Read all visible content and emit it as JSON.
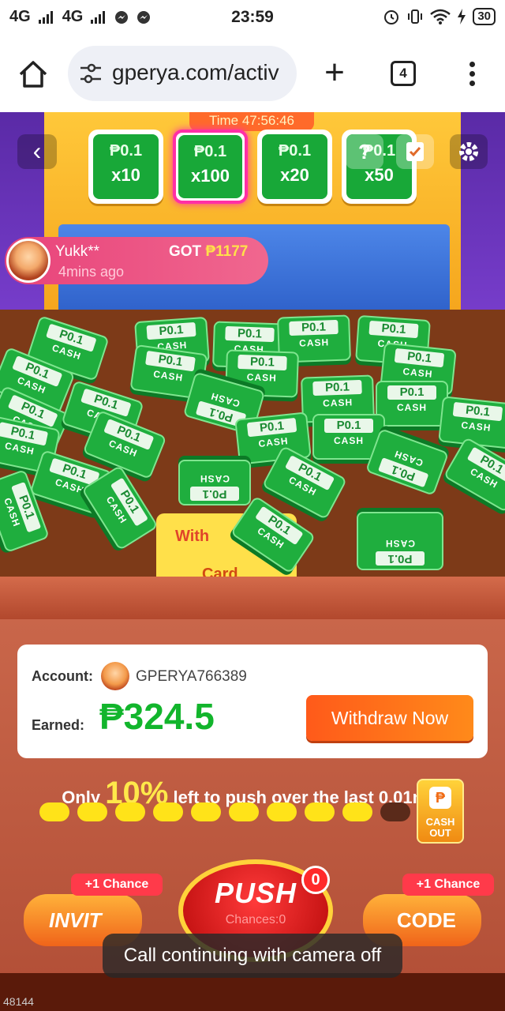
{
  "status_bar": {
    "signal1": "4G",
    "signal2": "4G",
    "time": "23:59",
    "battery": "30"
  },
  "browser": {
    "url": "gperya.com/activ",
    "tab_count": "4"
  },
  "game": {
    "timer": "Time 47:56:46",
    "back_label": "‹",
    "help_label": "?",
    "bet_options": [
      {
        "amount": "₱0.1",
        "multiplier": "x10"
      },
      {
        "amount": "₱0.1",
        "multiplier": "x100",
        "selected": true
      },
      {
        "amount": "₱0.1",
        "multiplier": "x20"
      },
      {
        "amount": "₱0.1",
        "multiplier": "x50"
      }
    ],
    "ticker": {
      "name": "Yukk**",
      "got_label": "GOT",
      "got_amount": "₱1177",
      "time_ago": "4mins ago"
    },
    "coin_amount": "P0.1",
    "coin_label": "CASH",
    "card_tile": {
      "top_text": "With",
      "bottom_text": "Card"
    }
  },
  "account": {
    "account_label": "Account:",
    "account_id": "GPERYA766389",
    "earned_label": "Earned:",
    "earned_amount": "₱324.5",
    "withdraw_label": "Withdraw Now"
  },
  "progress": {
    "prefix": "Only",
    "percent": "10%",
    "suffix": "left to push over the last 0.01mm",
    "filled_dots": 9,
    "total_dots": 10
  },
  "cashout": {
    "icon": "₱",
    "label": "CASH OUT"
  },
  "actions": {
    "invite_label": "INVIT",
    "code_label": "CODE",
    "invite_chance": "+1 Chance",
    "code_chance": "+1 Chance",
    "push_label": "PUSH",
    "push_badge": "0",
    "push_sub": "Chances:0"
  },
  "toast": "Call continuing with camera off",
  "corner_number": "48144",
  "colors": {
    "accent_green": "#12b52c",
    "withdraw_orange": "#ff5a1a",
    "progress_yellow": "#ffe319"
  }
}
